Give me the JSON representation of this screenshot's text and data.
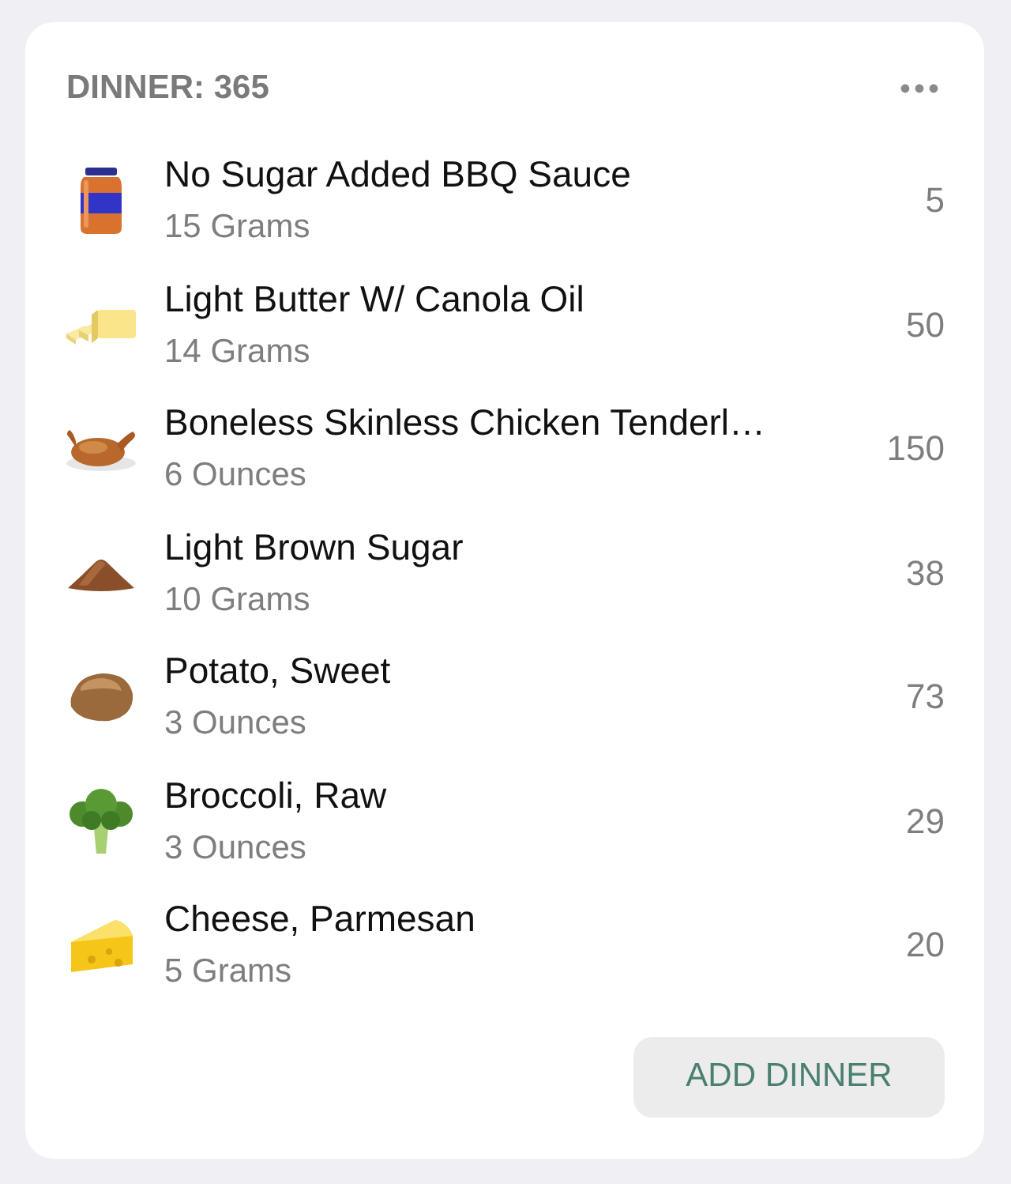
{
  "meal": {
    "title": "DINNER: 365"
  },
  "items": [
    {
      "name": "No Sugar Added BBQ Sauce",
      "amount": "15 Grams",
      "calories": "5"
    },
    {
      "name": "Light Butter W/ Canola Oil",
      "amount": "14 Grams",
      "calories": "50"
    },
    {
      "name": "Boneless Skinless Chicken Tenderl…",
      "amount": "6 Ounces",
      "calories": "150"
    },
    {
      "name": "Light Brown Sugar",
      "amount": "10 Grams",
      "calories": "38"
    },
    {
      "name": "Potato, Sweet",
      "amount": "3 Ounces",
      "calories": "73"
    },
    {
      "name": "Broccoli, Raw",
      "amount": "3 Ounces",
      "calories": "29"
    },
    {
      "name": "Cheese, Parmesan",
      "amount": "5 Grams",
      "calories": "20"
    }
  ],
  "add_button": {
    "label": "ADD DINNER"
  }
}
